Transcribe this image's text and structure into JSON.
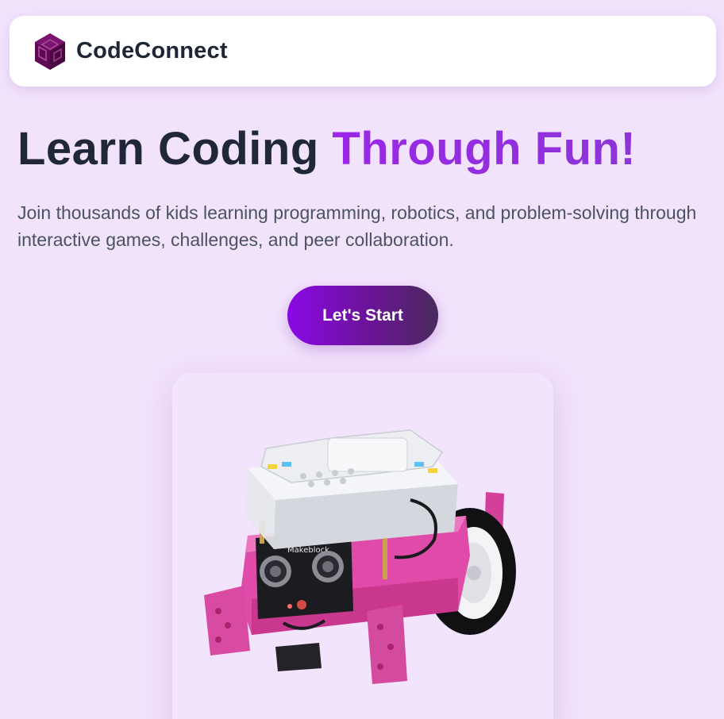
{
  "header": {
    "brand_name": "CodeConnect",
    "logo_icon": "cube-logo-icon"
  },
  "hero": {
    "title_main": "Learn Coding ",
    "title_accent": "Through Fun!",
    "subtitle": "Join thousands of kids learning programming, robotics, and problem-solving through interactive games, challenges, and peer collaboration.",
    "cta_label": "Let's Start"
  },
  "robot": {
    "brand_text": "Makeblock"
  },
  "colors": {
    "background": "#f2e3fd",
    "accent": "#9a2be2",
    "cta_gradient_start": "#8b08e6",
    "cta_gradient_end": "#4a2a5c",
    "logo": "#5c0a52",
    "title": "#1f2739"
  }
}
